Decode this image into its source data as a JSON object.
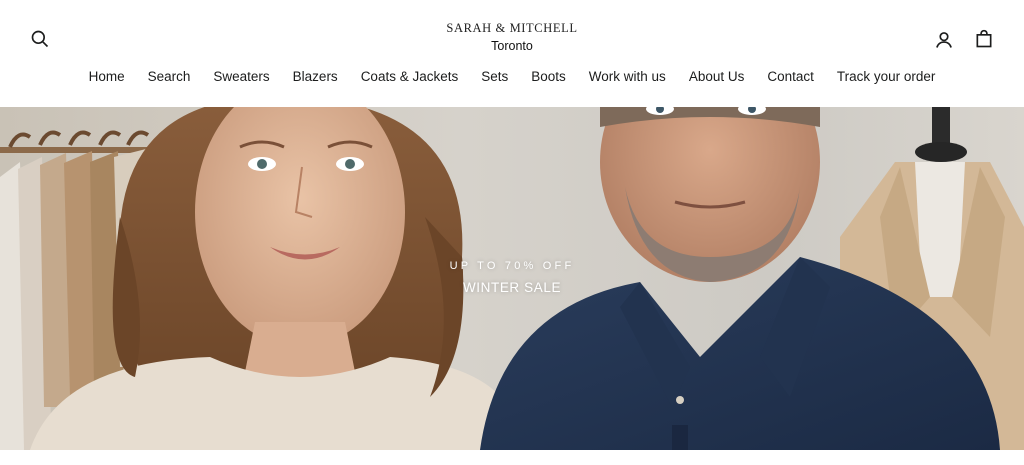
{
  "brand": {
    "logo_text": "SARAH & MITCHELL",
    "location": "Toronto"
  },
  "header": {
    "icons": [
      "search-icon",
      "account-icon",
      "cart-icon"
    ]
  },
  "nav": {
    "items": [
      {
        "label": "Home"
      },
      {
        "label": "Search"
      },
      {
        "label": "Sweaters"
      },
      {
        "label": "Blazers"
      },
      {
        "label": "Coats & Jackets"
      },
      {
        "label": "Sets"
      },
      {
        "label": "Boots"
      },
      {
        "label": "Work with us"
      },
      {
        "label": "About Us"
      },
      {
        "label": "Contact"
      },
      {
        "label": "Track your order"
      }
    ]
  },
  "hero": {
    "kicker": "UP TO 70% OFF",
    "title": "WINTER SALE"
  },
  "colors": {
    "text": "#1c1d1d",
    "background": "#ffffff",
    "hero_overlay_text": "#ffffff"
  }
}
